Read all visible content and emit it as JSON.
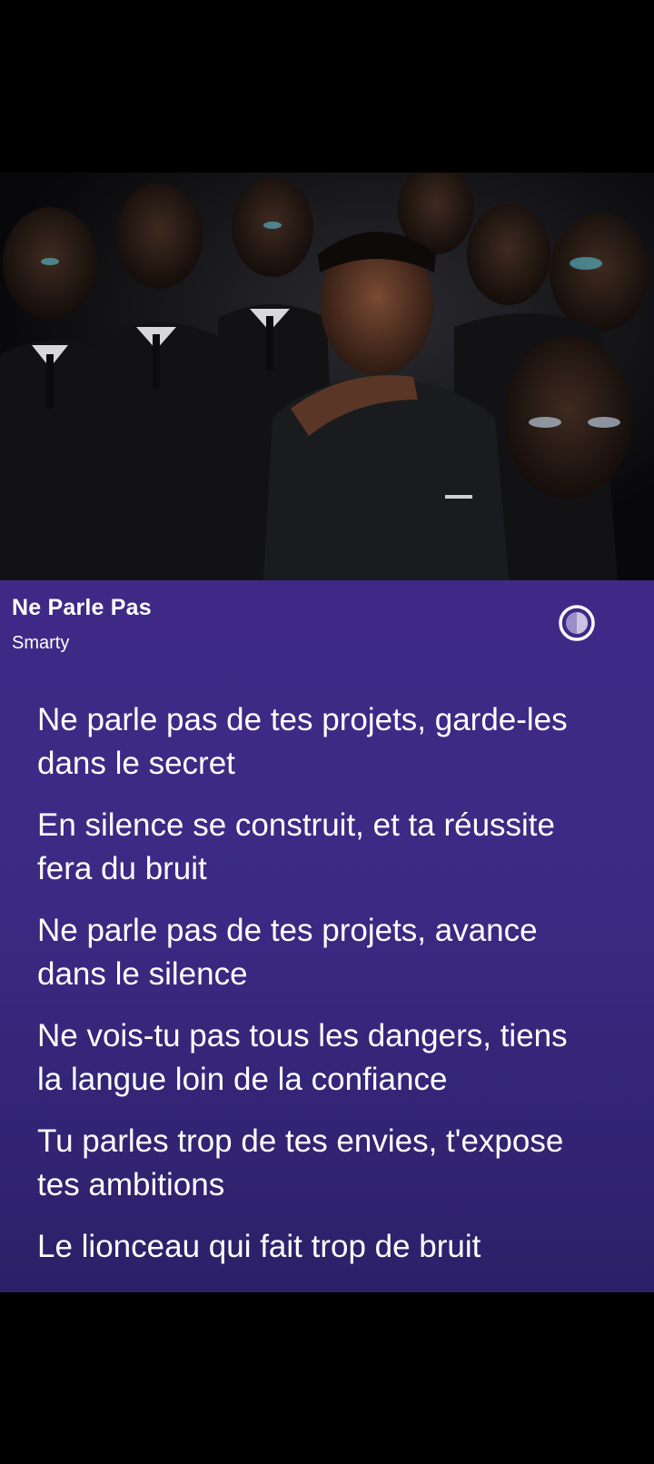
{
  "song": {
    "title": "Ne Parle Pas",
    "artist": "Smarty"
  },
  "icons": {
    "theme_toggle": "contrast-icon"
  },
  "colors": {
    "panel_top": "#3e2a86",
    "panel_bottom": "#2c2068",
    "text": "#ffffff"
  },
  "lyrics": [
    {
      "l1": "Ne parle pas de tes projets, garde-les",
      "l2": "dans le secret"
    },
    {
      "l1": "En silence se construit, et ta réussite",
      "l2": "fera du bruit"
    },
    {
      "l1": "Ne parle pas de tes projets, avance",
      "l2": "dans le silence"
    },
    {
      "l1": "Ne vois-tu pas tous les dangers, tiens",
      "l2": "la langue loin de la confiance"
    },
    {
      "l1": "Tu parles trop de tes envies, t'expose",
      "l2": "tes ambitions"
    },
    {
      "l1": "Le lionceau qui fait trop de bruit",
      "l2": ""
    }
  ]
}
